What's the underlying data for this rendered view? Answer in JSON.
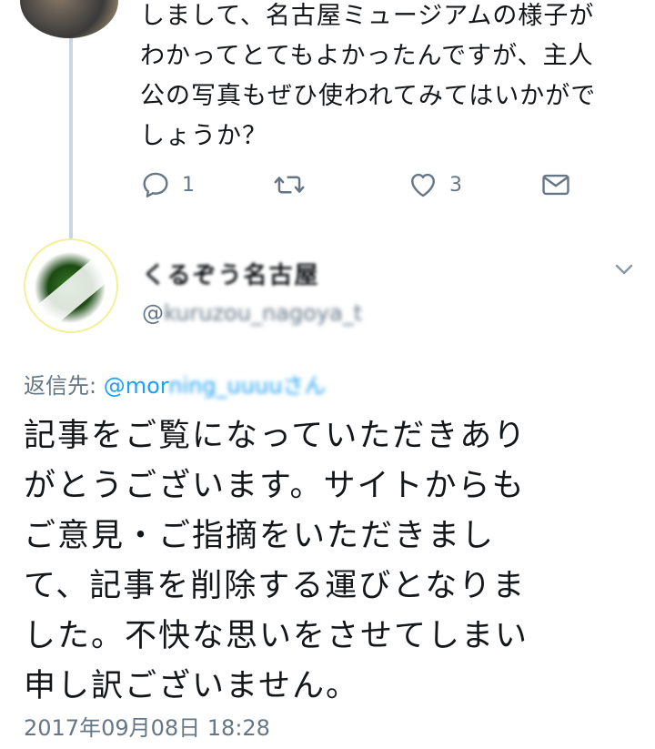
{
  "previous_tweet": {
    "text_lines": [
      "しまして、名古屋ミュージアムの様子が",
      "わかってとてもよかったんですが、主人",
      "公の写真もぜひ使われてみてはいかがで",
      "しょうか？"
    ],
    "actions": {
      "reply_count": "1",
      "retweet_count": "",
      "like_count": "3"
    }
  },
  "reply": {
    "display_name": "くるぞう名古屋",
    "handle": "@",
    "handle_obscured": "kuruzou_nagoya_t",
    "reply_to_label": "返信先: ",
    "reply_to_handle": "@mor",
    "reply_to_obscured": "ning_uuuuさん",
    "text_lines": [
      "記事をご覧になっていただきありがとうございます。サイトからもご意見・ご指摘をいただきまして、記事を削除する運びとなりました。不快な思いをさせてしまい申し訳ございません。"
    ],
    "display_lines": [
      "記事をご覧になっていただきあり",
      "がとうございます。サイトからも",
      "ご意見・ご指摘をいただきまし",
      "て、記事を削除する運びとなりま",
      "した。不快な思いをさせてしまい",
      "申し訳ございません。"
    ],
    "timestamp": "2017年09月08日 18:28"
  },
  "colors": {
    "text": "#14171a",
    "secondary": "#657786",
    "link": "#1da1f2",
    "thread_line": "#ccd6dd"
  }
}
